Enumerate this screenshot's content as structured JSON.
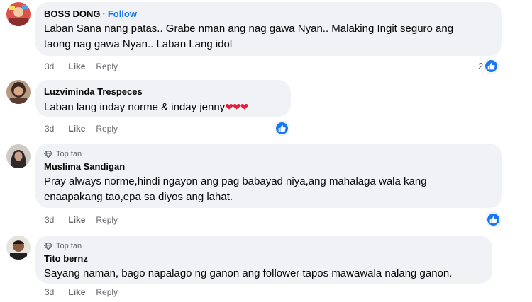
{
  "comments": [
    {
      "author": "BOSS DONG",
      "separator": "·",
      "follow": "Follow",
      "text_line1": "Laban Sana nang patas.. Grabe nman ang nag gawa Nyan.. Malaking Ingit seguro ang",
      "text_line2": "taong nag gawa Nyan.. Laban Lang idol",
      "time": "3d",
      "like": "Like",
      "reply": "Reply",
      "reaction_count": "2",
      "avatar_color": "#c9483f"
    },
    {
      "author": "Luzviminda Trespeces",
      "text": "Laban lang inday norme & inday jenny",
      "hearts": "❤❤❤",
      "time": "3d",
      "like": "Like",
      "reply": "Reply",
      "avatar_color": "#6b4a3a"
    },
    {
      "badge": "Top fan",
      "author": "Muslima Sandigan",
      "text_line1": "Pray always norme,hindi ngayon ang pag babayad niya,ang mahalaga wala kang",
      "text_line2": "enaapakang tao,epa sa diyos ang lahat.",
      "time": "3d",
      "like": "Like",
      "reply": "Reply",
      "avatar_color": "#3d3b3c"
    },
    {
      "badge": "Top fan",
      "author": "Tito bernz",
      "text": "Sayang naman, bago napalago ng ganon ang follower tapos mawawala nalang ganon.",
      "time": "3d",
      "like": "Like",
      "reply": "Reply",
      "avatar_color": "#2b2b2b"
    }
  ],
  "colors": {
    "bubble": "#f0f2f5",
    "accent": "#1877f2",
    "secondary_text": "#65676b",
    "heart": "#e41e3f"
  }
}
